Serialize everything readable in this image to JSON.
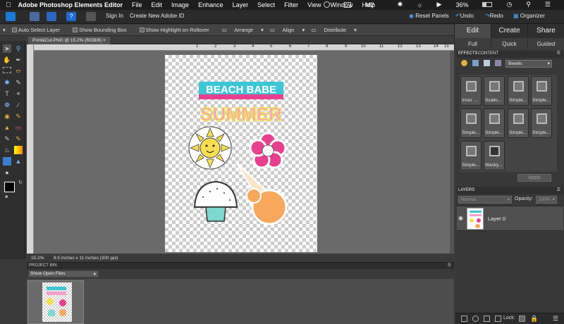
{
  "menubar": {
    "apple": "",
    "app_name": "Adobe Photoshop Elements Editor",
    "items": [
      "File",
      "Edit",
      "Image",
      "Enhance",
      "Layer",
      "Select",
      "Filter",
      "View",
      "Window",
      "Help"
    ],
    "status": {
      "wifi_count": "2",
      "battery": "36%",
      "clock_icon": "clock-icon"
    }
  },
  "toprow": {
    "sign_in": "Sign In",
    "create_id": "Create New Adobe ID",
    "reset_panels": "Reset Panels",
    "undo": "Undo",
    "redo": "Redo",
    "organizer": "Organizer"
  },
  "mode_tabs": [
    "Edit",
    "Create",
    "Share"
  ],
  "edit_subtabs": [
    "Full",
    "Quick",
    "Guided"
  ],
  "options": {
    "auto_select": "Auto Select Layer",
    "show_bbox": "Show Bounding Box",
    "show_highlight": "Show Highlight on Rollover",
    "arrange": "Arrange",
    "align": "Align",
    "distribute": "Distribute"
  },
  "document": {
    "tab_title": "Print&Cut.PNG @ 15.2% (RGB/8)",
    "zoom": "15.2%",
    "size": "8.5 inches x 11 inches (300 ppi)",
    "art_line1": "BEACH BABE",
    "art_line2": "SUMMER"
  },
  "ruler_numbers": [
    "1",
    "2",
    "3",
    "4",
    "5",
    "6",
    "7",
    "8",
    "9",
    "10",
    "11",
    "12",
    "13",
    "14",
    "15"
  ],
  "project_bin": {
    "header": "PROJECT BIN",
    "selector": "Show Open Files"
  },
  "effects": {
    "tab_effects": "EFFECTS",
    "tab_content": "CONTENT",
    "category": "Bevels",
    "items": [
      "Inner ...",
      "Scallo...",
      "Simple...",
      "Simple...",
      "Simple...",
      "Simple...",
      "Simple...",
      "Simple...",
      "Simple...",
      "Wacky..."
    ],
    "apply": "Apply"
  },
  "layers": {
    "header": "LAYERS",
    "blend_mode": "Normal",
    "opacity_label": "Opacity:",
    "opacity_value": "100%",
    "layer_name": "Layer 0",
    "lock_label": "Lock:"
  },
  "colors": {
    "accent_pink": "#e8408f",
    "accent_cyan": "#3cc6d6",
    "sun_yellow": "#f7de4f",
    "icecream_orange": "#f7a85c"
  }
}
